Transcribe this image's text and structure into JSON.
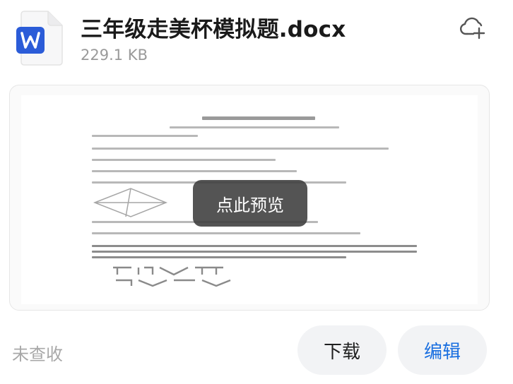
{
  "file": {
    "name": "三年级走美杯模拟题.docx",
    "size": "229.1 KB"
  },
  "preview": {
    "overlay_label": "点此预览"
  },
  "footer": {
    "status": "未查收",
    "download_label": "下载",
    "edit_label": "编辑"
  },
  "colors": {
    "word_blue": "#2b5cd8",
    "edit_blue": "#1a6fe0",
    "button_bg": "#f2f3f5"
  },
  "icons": {
    "file_type": "word-document-icon",
    "cloud": "cloud-upload-icon"
  }
}
